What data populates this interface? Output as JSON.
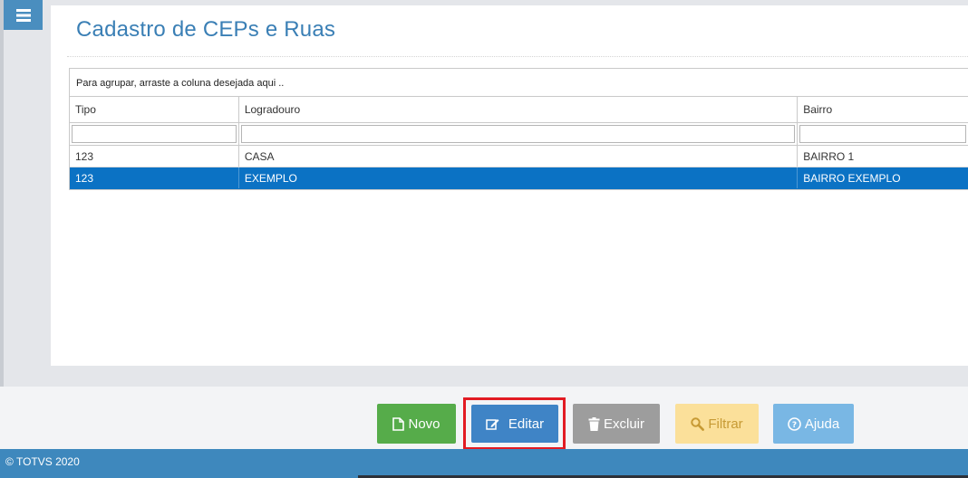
{
  "page": {
    "title": "Cadastro de CEPs e Ruas"
  },
  "grid": {
    "group_hint": "Para agrupar, arraste a coluna desejada aqui ..",
    "columns": [
      "Tipo",
      "Logradouro",
      "Bairro"
    ],
    "filters": [
      "",
      "",
      ""
    ],
    "rows": [
      {
        "tipo": "123",
        "logradouro": "CASA",
        "bairro": "BAIRRO 1",
        "selected": false
      },
      {
        "tipo": "123",
        "logradouro": "EXEMPLO",
        "bairro": "BAIRRO EXEMPLO",
        "selected": true
      }
    ]
  },
  "toolbar": {
    "novo_label": "Novo",
    "editar_label": "Editar",
    "excluir_label": "Excluir",
    "filtrar_label": "Filtrar",
    "ajuda_label": "Ajuda"
  },
  "footer": {
    "copyright": "© TOTVS 2020"
  },
  "icons": {
    "menu": "menu-icon",
    "novo": "new-file-icon",
    "editar": "edit-icon",
    "excluir": "trash-icon",
    "filtrar": "search-icon",
    "ajuda": "help-icon"
  },
  "colors": {
    "accent": "#3a7fb5",
    "selected_row": "#0b72c4",
    "novo": "#56ac4a",
    "editar": "#3f84c6",
    "excluir": "#9d9d9d",
    "filtrar": "#fbe09a",
    "ajuda": "#79b7e4",
    "highlight": "#e21b23"
  }
}
